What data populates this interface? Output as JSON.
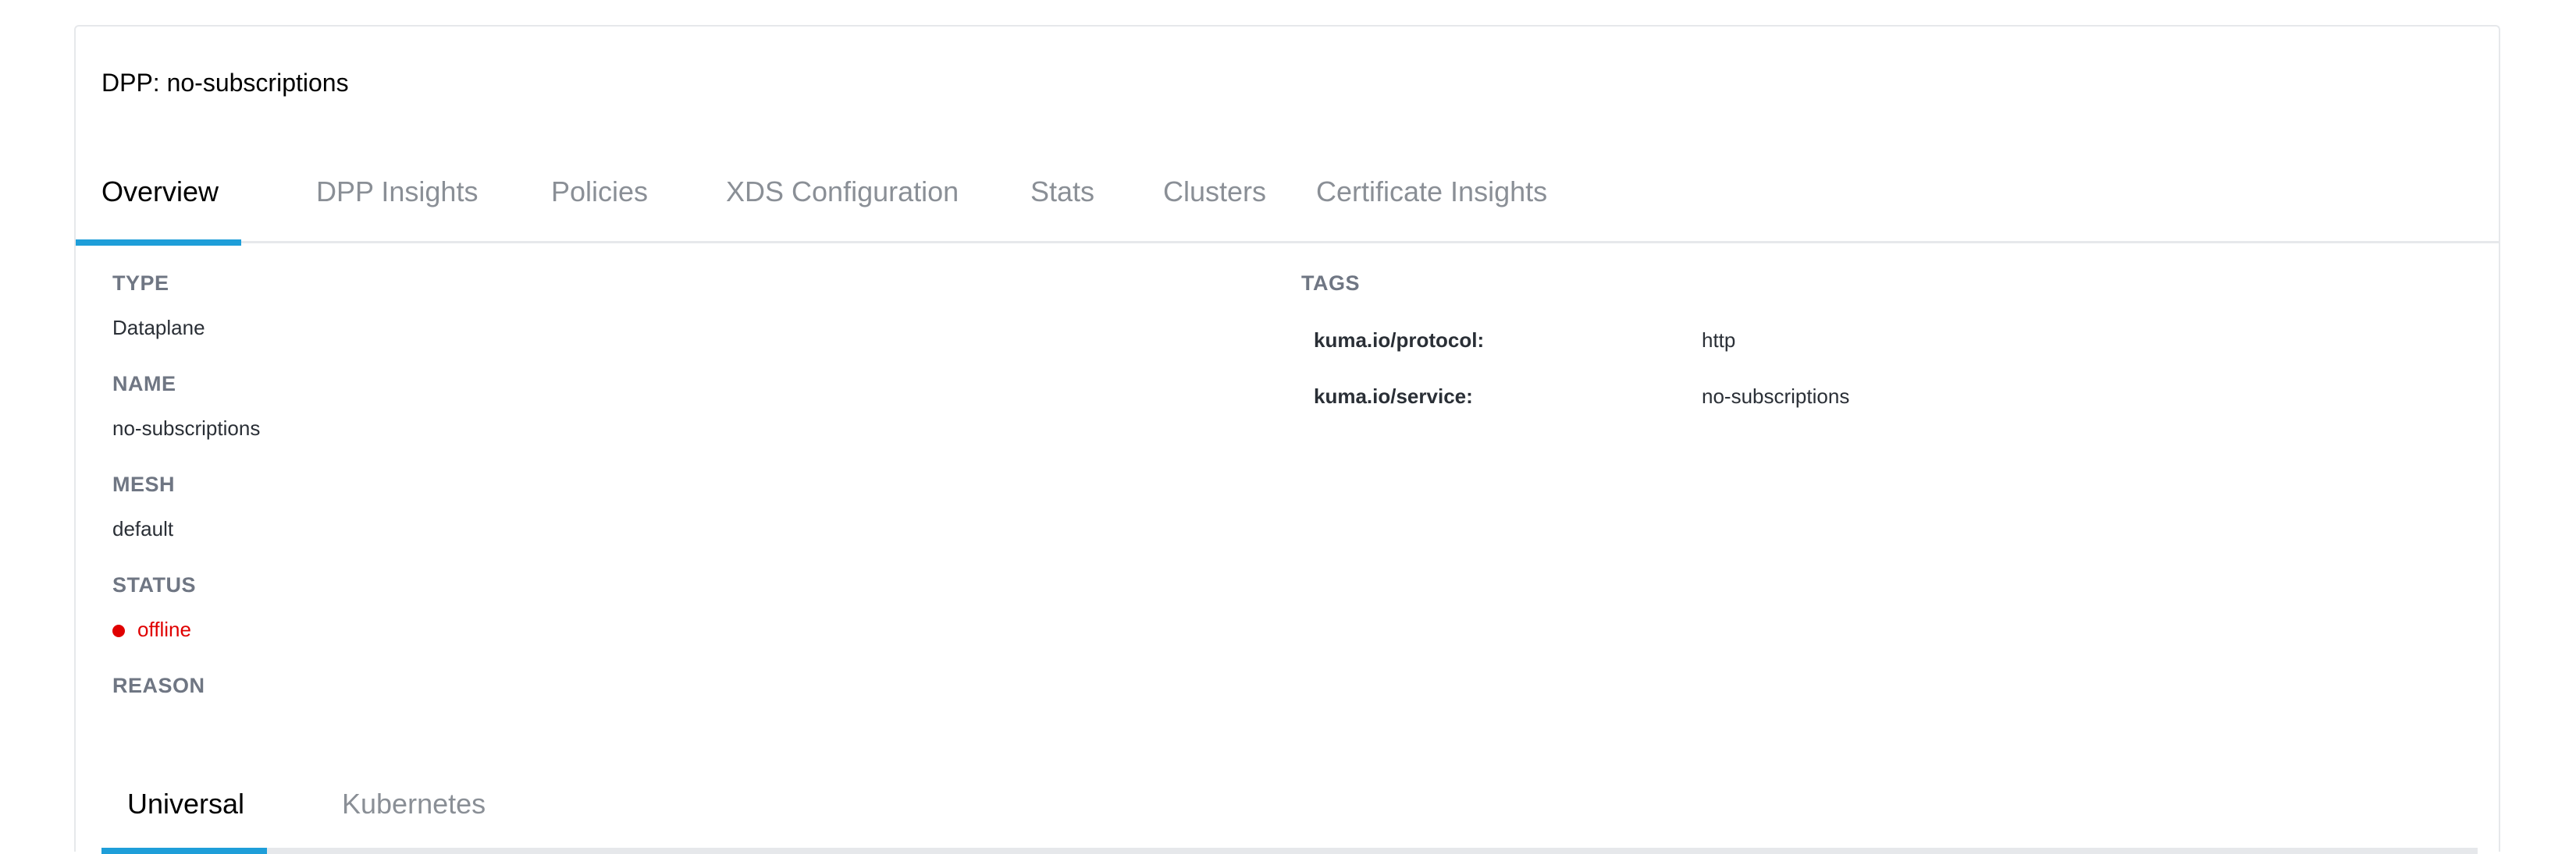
{
  "card": {
    "title": "DPP: no-subscriptions"
  },
  "tabs": [
    {
      "label": "Overview",
      "active": true
    },
    {
      "label": "DPP Insights",
      "active": false
    },
    {
      "label": "Policies",
      "active": false
    },
    {
      "label": "XDS Configuration",
      "active": false
    },
    {
      "label": "Stats",
      "active": false
    },
    {
      "label": "Clusters",
      "active": false
    },
    {
      "label": "Certificate Insights",
      "active": false
    }
  ],
  "overview": {
    "type_label": "TYPE",
    "type_value": "Dataplane",
    "name_label": "NAME",
    "name_value": "no-subscriptions",
    "mesh_label": "MESH",
    "mesh_value": "default",
    "status_label": "STATUS",
    "status_value": "offline",
    "reason_label": "REASON"
  },
  "tags": {
    "label": "TAGS",
    "items": [
      {
        "key": "kuma.io/protocol:",
        "value": "http"
      },
      {
        "key": "kuma.io/service:",
        "value": "no-subscriptions"
      }
    ]
  },
  "subtabs": [
    {
      "label": "Universal",
      "active": true
    },
    {
      "label": "Kubernetes",
      "active": false
    }
  ],
  "colors": {
    "accent": "#1e9ed9",
    "status_offline": "#e00000",
    "muted_text": "#8a8f96",
    "label_text": "#6f7683"
  }
}
